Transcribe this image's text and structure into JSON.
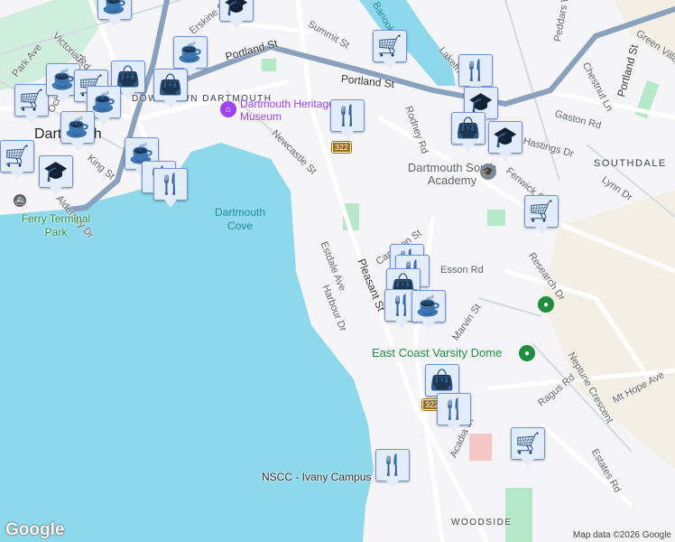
{
  "map": {
    "colors": {
      "land": "#f5f4f6",
      "water": "#8ed8ec",
      "park": "#b5e8c9",
      "highway": "#8aa1bd",
      "road": "#d3dae3",
      "marker_bg": "#e3ecfb",
      "marker_icon": "#0b3d63"
    },
    "streets": [
      "Victoria Rd",
      "Park Ave",
      "Ochterloney St",
      "King St",
      "Erskine St",
      "Summit St",
      "Portland St",
      "Portland St",
      "Newcastle St",
      "Estdale Ave",
      "Harbour Dr",
      "Pleasant St",
      "Cameron St",
      "Esson Rd",
      "Marvin St",
      "Rodney Rd",
      "Lakefrront Dr",
      "Peddars Way",
      "Chestnut Ln",
      "Green Village Ln",
      "Gaston Rd",
      "Hastings Dr",
      "Fenwick St",
      "Lynn Dr",
      "Research Dr",
      "Neptune Crescent",
      "Ragus Rd",
      "Mt Hope Ave",
      "Estates Rd",
      "Acadia St",
      "Portland St",
      "Alderney Dr"
    ],
    "places": {
      "downtown": "Dartmouth",
      "downtown_area": "DOWNTOWN DARTMOUTH",
      "museum": "Dartmouth Heritage Museum",
      "cove": "Dartmouth Cove",
      "ferry_park": "Ferry Terminal Park",
      "lake": "Banook Lake",
      "school": "Dartmouth South Academy",
      "southdale": "SOUTHDALE",
      "dome": "East Coast Varsity Dome",
      "nscc": "NSCC - Ivany Campus",
      "woodside": "WOODSIDE"
    },
    "route_shields": [
      "322",
      "322"
    ],
    "marker_types": [
      "coffee",
      "school",
      "coffee",
      "shopping",
      "grocery",
      "grocery",
      "coffee",
      "grocery",
      "shopping",
      "coffee",
      "coffee",
      "grocery",
      "school",
      "coffee",
      "restaurant",
      "restaurant",
      "restaurant",
      "restaurant",
      "school",
      "shopping",
      "school",
      "grocery",
      "restaurant",
      "restaurant",
      "shopping",
      "restaurant",
      "coffee",
      "shopping",
      "restaurant",
      "grocery",
      "restaurant"
    ],
    "logo": "Google",
    "attribution": "Map data ©2026 Google"
  }
}
